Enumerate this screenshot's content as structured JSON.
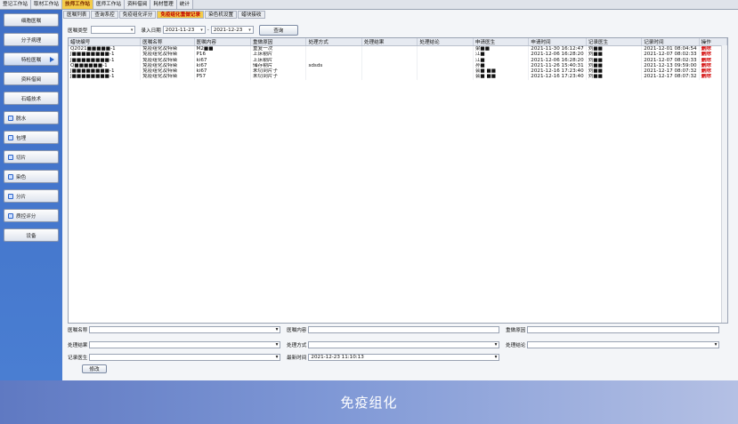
{
  "top_nav": {
    "tabs": [
      "登记工作站",
      "取材工作站",
      "技师工作站",
      "医师工作站",
      "资料借阅",
      "耗材管理",
      "统计"
    ],
    "active_index": 2
  },
  "sidebar": {
    "items": [
      {
        "label": "细胞医嘱",
        "icon": "",
        "active": false
      },
      {
        "label": "分子病理",
        "icon": "",
        "active": false
      },
      {
        "label": "特检医嘱",
        "icon": "",
        "active": true
      },
      {
        "label": "资料借阅",
        "icon": "",
        "active": false
      },
      {
        "label": "石蜡技术",
        "icon": "",
        "active": false
      },
      {
        "label": "脱水",
        "icon": "flask-icon",
        "active": false
      },
      {
        "label": "包埋",
        "icon": "box-icon",
        "active": false
      },
      {
        "label": "切片",
        "icon": "slice-icon",
        "active": false
      },
      {
        "label": "染色",
        "icon": "brush-icon",
        "active": false
      },
      {
        "label": "分片",
        "icon": "split-icon",
        "active": false
      },
      {
        "label": "质控评分",
        "icon": "score-icon",
        "active": false
      },
      {
        "label": "设备",
        "icon": "",
        "active": false
      }
    ]
  },
  "sub_tabs": {
    "tabs": [
      "医嘱列表",
      "查询系控",
      "免疫组化评分",
      "免疫组化重做记录",
      "染色机设置",
      "蜡块接收"
    ],
    "active_index": 3
  },
  "filter": {
    "type_label": "医嘱类型",
    "type_value": "",
    "date_label": "录入日期",
    "date_from": "2021-11-23",
    "date_sep": "-",
    "date_to": "2021-12-23",
    "query_button": "查询"
  },
  "table": {
    "columns": [
      "蜡块编号",
      "医嘱名称",
      "医嘱内容",
      "重做原因",
      "处理方式",
      "处理结果",
      "处理结论",
      "申请医生",
      "申请时间",
      "记录医生",
      "记录时间",
      "操作"
    ],
    "rows": [
      [
        "Q2021■■■■■-1",
        "免疫组化及特染",
        "M2■■",
        "重复一次",
        "",
        "",
        "",
        "梁■■",
        "2021-11-30 16:12:47",
        "刘■■",
        "2021-12-01 08:04:54",
        "删除"
      ],
      [
        "J■■■■■■■■-1",
        "免疫组化及特染",
        "P16",
        "上床剔片",
        "",
        "",
        "",
        "江■",
        "2021-12-06 16:28:20",
        "刘■■",
        "2021-12-07 08:02:33",
        "删除"
      ],
      [
        "J■■■■■■■■-1",
        "免疫组化及特染",
        "ki67",
        "上床剔片",
        "",
        "",
        "",
        "江■",
        "2021-12-06 16:28:20",
        "刘■■",
        "2021-12-07 08:02:33",
        "删除"
      ],
      [
        "Q■■■■■■-1",
        "免疫组化及特染",
        "ki67",
        "储存剔片",
        "sdsds",
        "",
        "",
        "孙■",
        "2021-11-26 15:40:31",
        "刘■■",
        "2021-12-13 09:59:00",
        "删除"
      ],
      [
        "J■■■■■■■■-1",
        "免疫组化及特染",
        "ki67",
        "未切到片子",
        "",
        "",
        "",
        "会■ ■■",
        "2021-12-16 17:23:40",
        "刘■■",
        "2021-12-17 08:07:32",
        "删除"
      ],
      [
        "J■■■■■■■■-1",
        "免疫组化及特染",
        "P57",
        "未切到片子",
        "",
        "",
        "",
        "会■ ■■",
        "2021-12-16 17:23:40",
        "刘■■",
        "2021-12-17 08:07:32",
        "删除"
      ]
    ]
  },
  "form": {
    "order_name_label": "医嘱名称",
    "order_name_value": "",
    "order_content_label": "医嘱内容",
    "order_content_value": "",
    "redo_reason_label": "重做原因",
    "redo_reason_value": "",
    "result_label": "处理结果",
    "result_value": "",
    "method_label": "处理方式",
    "method_value": "",
    "conclusion_label": "处理结论",
    "conclusion_value": "",
    "record_doctor_label": "记录医生",
    "record_doctor_value": "",
    "record_time_label": "最新时间",
    "record_time_value": "2021-12-23 11:10:13",
    "edit_button": "修改"
  },
  "banner": {
    "text": "免疫组化"
  }
}
